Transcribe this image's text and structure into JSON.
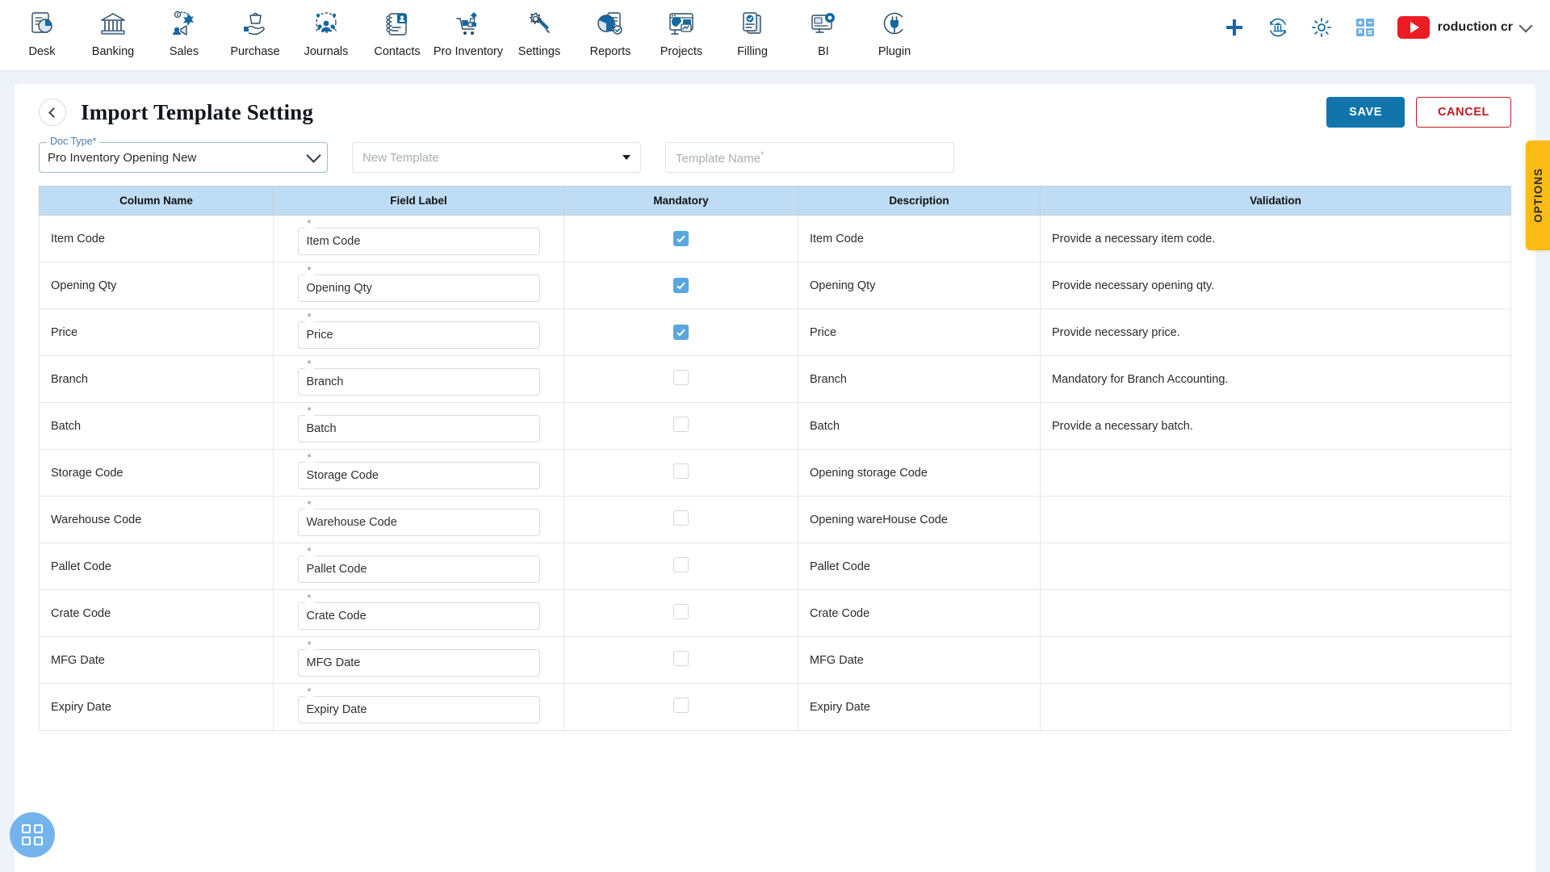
{
  "topnav": {
    "items": [
      {
        "label": "Desk",
        "icon": "desk-dashboard-icon"
      },
      {
        "label": "Banking",
        "icon": "bank-icon"
      },
      {
        "label": "Sales",
        "icon": "sales-megaphone-icon"
      },
      {
        "label": "Purchase",
        "icon": "purchase-hand-bag-icon"
      },
      {
        "label": "Journals",
        "icon": "journals-people-gear-icon"
      },
      {
        "label": "Contacts",
        "icon": "contacts-book-icon"
      },
      {
        "label": "Pro Inventory",
        "icon": "inventory-cart-icon"
      },
      {
        "label": "Settings",
        "icon": "settings-gear-wrench-icon"
      },
      {
        "label": "Reports",
        "icon": "reports-pie-doc-icon"
      },
      {
        "label": "Projects",
        "icon": "projects-dashboard-icon"
      },
      {
        "label": "Filling",
        "icon": "filling-check-doc-icon"
      },
      {
        "label": "BI",
        "icon": "bi-monitor-gear-icon"
      },
      {
        "label": "Plugin",
        "icon": "plugin-plug-icon"
      }
    ],
    "right": {
      "add_icon": "plus-icon",
      "sync_bank_icon": "bank-sync-icon",
      "settings_icon": "gear-icon",
      "calculator_icon": "calculator-icon",
      "video_icon": "youtube-play-icon",
      "user_name": "roduction cr",
      "user_chevron_icon": "chevron-down-icon"
    }
  },
  "header": {
    "back_icon": "back-chevron-icon",
    "title": "Import Template Setting",
    "save_label": "SAVE",
    "cancel_label": "CANCEL"
  },
  "filters": {
    "doc_type": {
      "label": "Doc Type*",
      "value": "Pro Inventory Opening New",
      "chevron_icon": "chevron-down-icon"
    },
    "template_select": {
      "placeholder": "New Template",
      "caret_icon": "caret-down-icon"
    },
    "template_name": {
      "placeholder": "Template Name",
      "required_mark": "*"
    }
  },
  "options_tab": {
    "label": "OPTIONS"
  },
  "fab": {
    "icon": "grid-apps-icon"
  },
  "table": {
    "columns": [
      "Column Name",
      "Field Label",
      "Mandatory",
      "Description",
      "Validation"
    ],
    "required_mark": "*",
    "rows": [
      {
        "column_name": "Item Code",
        "field_label": "Item Code",
        "mandatory": true,
        "description": "Item Code",
        "validation": "Provide a necessary item code."
      },
      {
        "column_name": "Opening Qty",
        "field_label": "Opening Qty",
        "mandatory": true,
        "description": "Opening Qty",
        "validation": "Provide necessary opening qty."
      },
      {
        "column_name": "Price",
        "field_label": "Price",
        "mandatory": true,
        "description": "Price",
        "validation": "Provide necessary price."
      },
      {
        "column_name": "Branch",
        "field_label": "Branch",
        "mandatory": false,
        "description": "Branch",
        "validation": "Mandatory for Branch Accounting."
      },
      {
        "column_name": "Batch",
        "field_label": "Batch",
        "mandatory": false,
        "description": "Batch",
        "validation": "Provide a necessary batch."
      },
      {
        "column_name": "Storage Code",
        "field_label": "Storage Code",
        "mandatory": false,
        "description": "Opening storage Code",
        "validation": ""
      },
      {
        "column_name": "Warehouse Code",
        "field_label": "Warehouse Code",
        "mandatory": false,
        "description": "Opening wareHouse Code",
        "validation": ""
      },
      {
        "column_name": "Pallet Code",
        "field_label": "Pallet Code",
        "mandatory": false,
        "description": "Pallet Code",
        "validation": ""
      },
      {
        "column_name": "Crate Code",
        "field_label": "Crate Code",
        "mandatory": false,
        "description": "Crate Code",
        "validation": ""
      },
      {
        "column_name": "MFG Date",
        "field_label": "MFG Date",
        "mandatory": false,
        "description": "MFG Date",
        "validation": ""
      },
      {
        "column_name": "Expiry Date",
        "field_label": "Expiry Date",
        "mandatory": false,
        "description": "Expiry Date",
        "validation": ""
      }
    ]
  },
  "colors": {
    "primary": "#1175ab",
    "danger": "#c21a22",
    "table_header": "#bfdcf5",
    "checkbox_on": "#59a7de",
    "options_tab": "#fbbc16",
    "page_bg": "#eef2f9"
  }
}
